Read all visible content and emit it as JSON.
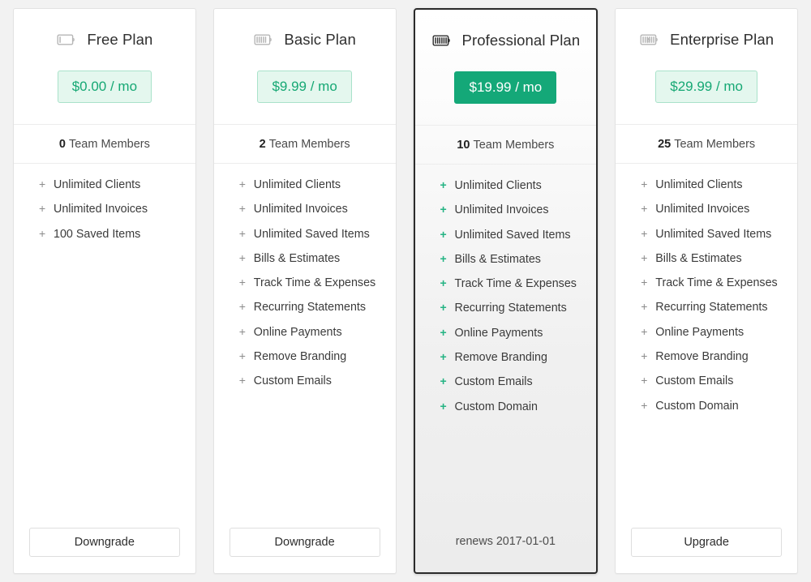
{
  "plans": [
    {
      "id": "free",
      "title": "Free Plan",
      "icon": "battery-empty-icon",
      "battery_level": 1,
      "battery_charging": false,
      "battery_style": "light",
      "price": "$0.00 / mo",
      "featured": false,
      "members_count": "0",
      "members_label": "Team Members",
      "features": [
        "Unlimited Clients",
        "Unlimited Invoices",
        "100 Saved Items"
      ],
      "footer_type": "button",
      "footer_label": "Downgrade"
    },
    {
      "id": "basic",
      "title": "Basic Plan",
      "icon": "battery-half-icon",
      "battery_level": 5,
      "battery_charging": false,
      "battery_style": "light",
      "price": "$9.99 / mo",
      "featured": false,
      "members_count": "2",
      "members_label": "Team Members",
      "features": [
        "Unlimited Clients",
        "Unlimited Invoices",
        "Unlimited Saved Items",
        "Bills & Estimates",
        "Track Time & Expenses",
        "Recurring Statements",
        "Online Payments",
        "Remove Branding",
        "Custom Emails"
      ],
      "footer_type": "button",
      "footer_label": "Downgrade"
    },
    {
      "id": "professional",
      "title": "Professional Plan",
      "icon": "battery-full-icon",
      "battery_level": 7,
      "battery_charging": false,
      "battery_style": "dark",
      "price": "$19.99 / mo",
      "featured": true,
      "members_count": "10",
      "members_label": "Team Members",
      "features": [
        "Unlimited Clients",
        "Unlimited Invoices",
        "Unlimited Saved Items",
        "Bills & Estimates",
        "Track Time & Expenses",
        "Recurring Statements",
        "Online Payments",
        "Remove Branding",
        "Custom Emails",
        "Custom Domain"
      ],
      "footer_type": "note",
      "footer_label": "renews 2017-01-01"
    },
    {
      "id": "enterprise",
      "title": "Enterprise Plan",
      "icon": "battery-charging-icon",
      "battery_level": 6,
      "battery_charging": true,
      "battery_style": "light",
      "price": "$29.99 / mo",
      "featured": false,
      "members_count": "25",
      "members_label": "Team Members",
      "features": [
        "Unlimited Clients",
        "Unlimited Invoices",
        "Unlimited Saved Items",
        "Bills & Estimates",
        "Track Time & Expenses",
        "Recurring Statements",
        "Online Payments",
        "Remove Branding",
        "Custom Emails",
        "Custom Domain"
      ],
      "footer_type": "button",
      "footer_label": "Upgrade"
    }
  ],
  "feature_marker": "+",
  "colors": {
    "page_background": "#f2f2f2",
    "card_background": "#ffffff",
    "featured_border": "#2b2b2b",
    "accent_green": "#14a878",
    "badge_background": "#e4f7ee",
    "badge_border": "#a9e2ca",
    "badge_text": "#16a874",
    "plus_marker": "#8c8c8c",
    "plus_marker_featured": "#24b383"
  }
}
